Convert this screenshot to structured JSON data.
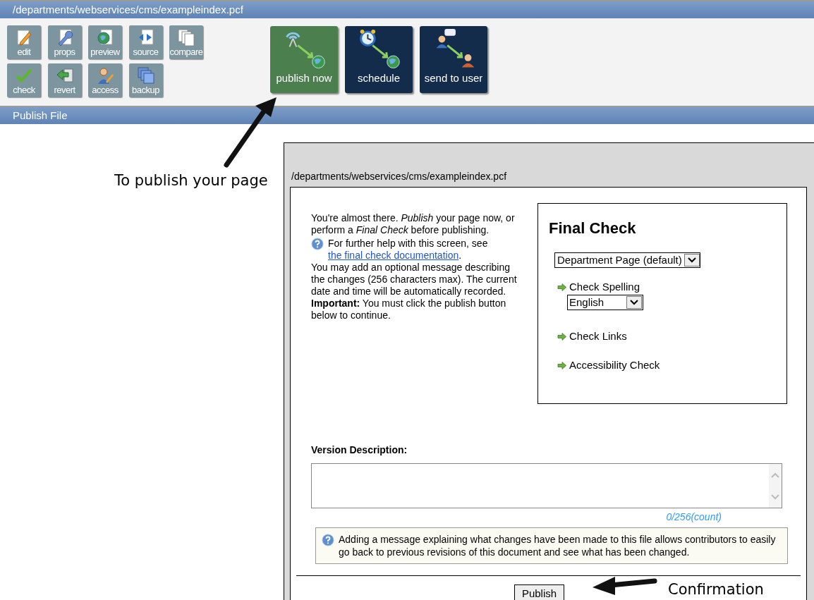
{
  "window": {
    "path": "/departments/webservices/cms/exampleindex.pcf"
  },
  "toolbar": {
    "small_buttons": [
      {
        "kind": "edit",
        "label": "edit"
      },
      {
        "kind": "props",
        "label": "props"
      },
      {
        "kind": "preview",
        "label": "preview"
      },
      {
        "kind": "source",
        "label": "source"
      },
      {
        "kind": "compare",
        "label": "compare"
      },
      {
        "kind": "check",
        "label": "check"
      },
      {
        "kind": "revert",
        "label": "revert"
      },
      {
        "kind": "access",
        "label": "access"
      },
      {
        "kind": "backup",
        "label": "backup"
      }
    ],
    "big_buttons": [
      {
        "kind": "publish",
        "label": "publish now",
        "selected": true
      },
      {
        "kind": "schedule",
        "label": "schedule",
        "selected": false
      },
      {
        "kind": "send",
        "label": "send to user",
        "selected": false
      }
    ]
  },
  "section_bar": {
    "title": "Publish File"
  },
  "dialog": {
    "path": "/departments/webservices/cms/exampleindex.pcf",
    "intro": "You're almost there. *Publish* your page now, or perform a *Final Check* before publishing.",
    "help": {
      "text": "For further help with this screen, see ",
      "link": "the final check documentation",
      "after": "."
    },
    "message": "You may add an optional message describing the changes (256 characters max). The current date and time will be automatically recorded.",
    "important": "**Important:** You must click the publish button below to continue.",
    "final_check": {
      "title": "Final Check",
      "template": "Department Page (default)",
      "items": [
        {
          "kind": "action",
          "label": "Check Spelling"
        },
        {
          "kind": "select",
          "value": "English"
        },
        {
          "kind": "action",
          "label": "Check Links"
        },
        {
          "kind": "action",
          "label": "Accessibility Check"
        }
      ]
    },
    "version_label": "Version Description:",
    "counter": "0/256(count)",
    "note": "Adding a message explaining what changes have been made to this file allows contributors to easily go back to previous revisions of this document and see what has been changed.",
    "button": "Publish"
  },
  "annotations": [
    {
      "kind": "up",
      "text": "To publish your page"
    },
    {
      "kind": "left",
      "text": "Confirmation"
    }
  ]
}
